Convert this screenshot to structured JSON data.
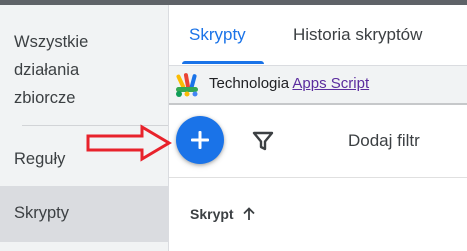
{
  "sidebar": {
    "items": [
      {
        "label": "Wszystkie\ndziałania\nzbiorcze"
      },
      {
        "label": "Reguły"
      },
      {
        "label": "Skrypty",
        "active": true
      }
    ]
  },
  "tabs": [
    {
      "label": "Skrypty",
      "active": true
    },
    {
      "label": "Historia skryptów"
    }
  ],
  "banner": {
    "text": "Technologia",
    "link": "Apps Script",
    "icon": "apps-script-logo"
  },
  "toolbar": {
    "add_button_icon": "plus-icon",
    "filter_icon": "filter-icon",
    "add_filter_label": "Dodaj filtr"
  },
  "table": {
    "columns": [
      {
        "label": "Skrypt",
        "sort": "ascending"
      }
    ]
  },
  "annotation": {
    "arrow_color": "#e8222b"
  },
  "colors": {
    "accent": "#1a73e8",
    "sidebar_bg": "#f1f3f4",
    "sidebar_active_bg": "#dadce0",
    "link": "#5b2c9e"
  }
}
